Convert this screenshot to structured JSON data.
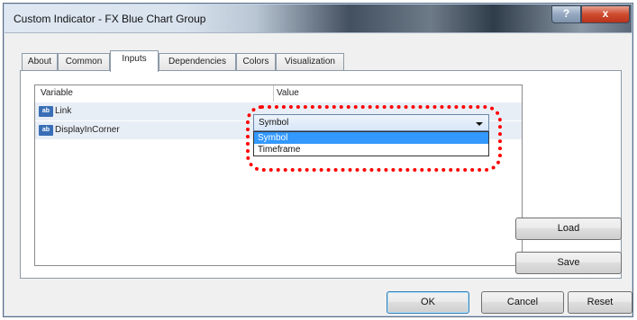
{
  "window": {
    "title": "Custom Indicator - FX Blue Chart Group",
    "help_label": "?",
    "close_label": "x"
  },
  "tabs": [
    "About",
    "Common",
    "Inputs",
    "Dependencies",
    "Colors",
    "Visualization"
  ],
  "active_tab": "Inputs",
  "grid": {
    "columns": [
      "Variable",
      "Value"
    ],
    "rows": [
      {
        "type_icon": "ab",
        "variable": "Link",
        "value": "Symbol"
      },
      {
        "type_icon": "ab",
        "variable": "DisplayInCorner",
        "value": ""
      }
    ]
  },
  "dropdown": {
    "selected": "Symbol",
    "options": [
      "Symbol",
      "Timeframe"
    ],
    "highlighted_index": 0
  },
  "buttons": {
    "load": "Load",
    "save": "Save",
    "ok": "OK",
    "cancel": "Cancel",
    "reset": "Reset"
  },
  "colors": {
    "highlight_dotted": "#ff0000",
    "selection": "#3399ff"
  }
}
